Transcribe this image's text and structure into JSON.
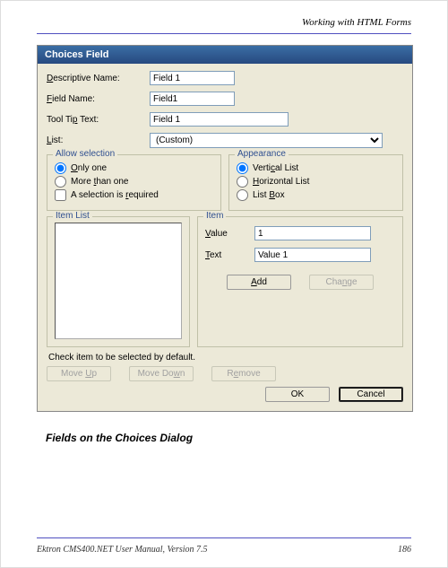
{
  "header": {
    "section_title": "Working with HTML Forms"
  },
  "dialog": {
    "title": "Choices Field",
    "labels": {
      "descriptive_name": "Descriptive Name:",
      "field_name": "Field Name:",
      "tool_tip_text": "Tool Tip Text:",
      "list": "List:"
    },
    "values": {
      "descriptive_name": "Field 1",
      "field_name": "Field1",
      "tool_tip_text": "Field 1",
      "list_selected": "(Custom)"
    },
    "allow_selection": {
      "legend": "Allow selection",
      "only_one": "Only one",
      "more_than_one": "More than one",
      "required": "A selection is required",
      "selected": "only_one",
      "required_checked": false
    },
    "appearance": {
      "legend": "Appearance",
      "vertical": "Vertical List",
      "horizontal": "Horizontal List",
      "listbox": "List Box",
      "selected": "vertical"
    },
    "item_list": {
      "legend": "Item List"
    },
    "item": {
      "legend": "Item",
      "value_label": "Value",
      "text_label": "Text",
      "value": "1",
      "text": "Value 1"
    },
    "buttons": {
      "add": "Add",
      "change": "Change",
      "move_up": "Move Up",
      "move_down": "Move Down",
      "remove": "Remove",
      "ok": "OK",
      "cancel": "Cancel"
    },
    "hint": "Check item to be selected by default."
  },
  "caption": "Fields on the Choices Dialog",
  "footer": {
    "manual": "Ektron CMS400.NET User Manual, Version 7.5",
    "page": "186"
  }
}
